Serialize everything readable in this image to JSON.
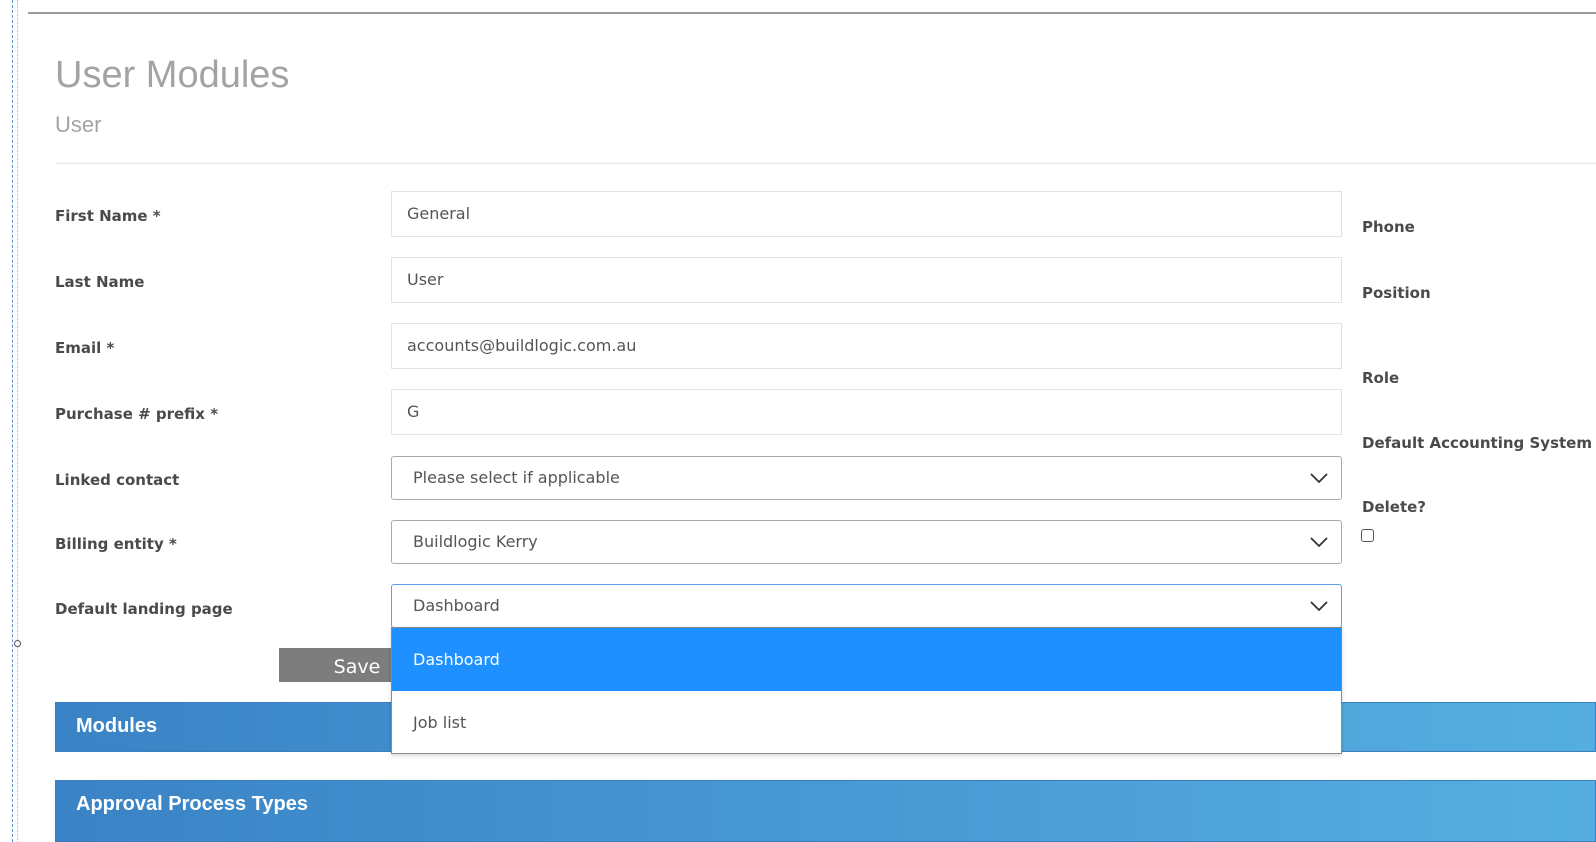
{
  "header": {
    "title": "User Modules",
    "subtitle": "User"
  },
  "form": {
    "first_name": {
      "label": "First Name *",
      "value": "General"
    },
    "last_name": {
      "label": "Last Name",
      "value": "User"
    },
    "email": {
      "label": "Email *",
      "value": "accounts@buildlogic.com.au"
    },
    "purchase_prefix": {
      "label": "Purchase # prefix *",
      "value": "G"
    },
    "linked_contact": {
      "label": "Linked contact",
      "selected": "Please select if applicable"
    },
    "billing_entity": {
      "label": "Billing entity *",
      "selected": "Buildlogic Kerry"
    },
    "landing_page": {
      "label": "Default landing page",
      "selected": "Dashboard",
      "options": [
        "Dashboard",
        "Job list"
      ]
    },
    "save_label": "Save"
  },
  "right_column": {
    "phone": "Phone",
    "position": "Position",
    "role": "Role",
    "accounting": "Default Accounting System",
    "delete": "Delete?",
    "delete_checked": false
  },
  "panels": {
    "modules": "Modules",
    "approval": "Approval Process Types"
  },
  "colors": {
    "panel_start": "#3a83c6",
    "panel_end": "#55aee0",
    "selected_option": "#1e90ff",
    "save_button": "#7d7d7d"
  }
}
